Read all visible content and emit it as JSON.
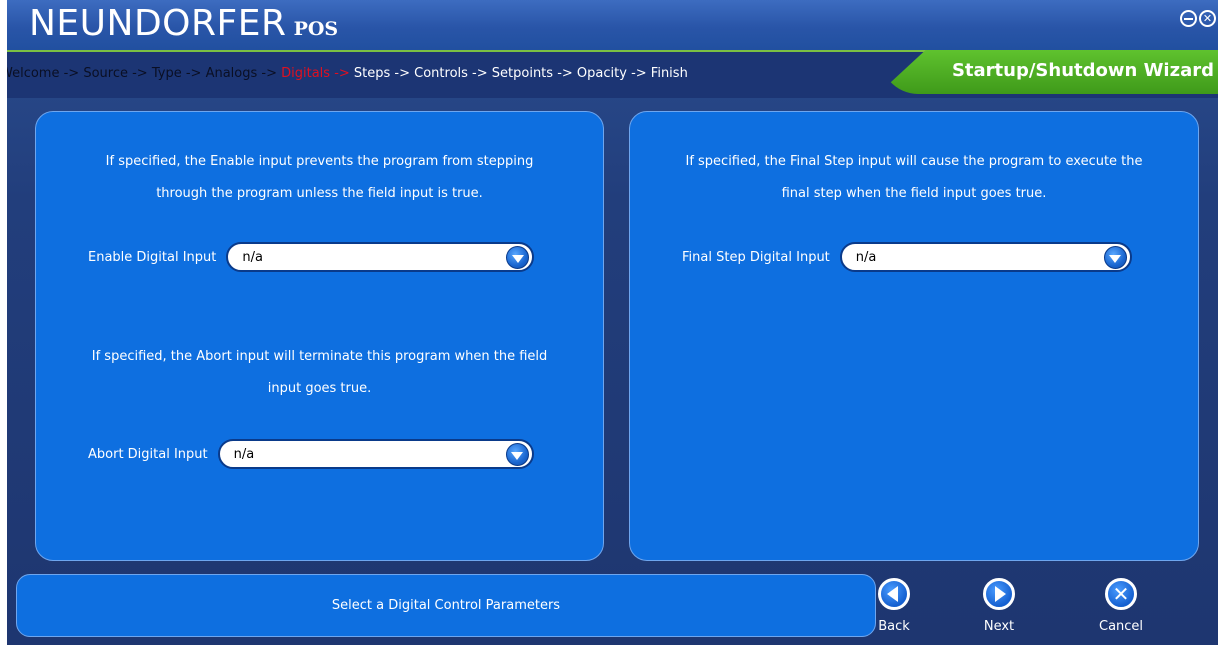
{
  "app": {
    "brand_name": "NEUNDORFER",
    "brand_suffix": "POS",
    "wizard_title": "Startup/Shutdown Wizard"
  },
  "colors": {
    "panel_blue": "#0e6fe0",
    "background_navy": "#1e3670",
    "wizard_tab_green": "#4fae22",
    "current_step_red": "#e01020"
  },
  "window_controls": [
    {
      "name": "minimize",
      "icon": "minimize-circle-icon"
    },
    {
      "name": "close",
      "icon": "close-circle-icon"
    }
  ],
  "breadcrumb": {
    "steps": [
      {
        "label": "Welcome",
        "state": "done"
      },
      {
        "label": "Source",
        "state": "done"
      },
      {
        "label": "Type",
        "state": "done"
      },
      {
        "label": "Analogs",
        "state": "done"
      },
      {
        "label": "Digitals",
        "state": "current"
      },
      {
        "label": "Steps",
        "state": "todo"
      },
      {
        "label": "Controls",
        "state": "todo"
      },
      {
        "label": "Setpoints",
        "state": "todo"
      },
      {
        "label": "Opacity",
        "state": "todo"
      },
      {
        "label": "Finish",
        "state": "todo"
      }
    ],
    "separator": " -> "
  },
  "left_panel": {
    "enable_desc_line1": "If specified, the Enable input prevents the program from stepping",
    "enable_desc_line2": "through the program unless the field input is true.",
    "enable_label": "Enable Digital Input",
    "enable_value": "n/a",
    "abort_desc_line1": "If specified, the Abort input will terminate this program when the field",
    "abort_desc_line2": "input goes true.",
    "abort_label": "Abort Digital Input",
    "abort_value": "n/a"
  },
  "right_panel": {
    "final_desc_line1": "If specified, the Final Step input will cause the program to execute the",
    "final_desc_line2": "final step when the field input goes true.",
    "final_label": "Final Step Digital Input",
    "final_value": "n/a"
  },
  "status": {
    "message": "Select a Digital Control Parameters"
  },
  "nav": {
    "back_label": "Back",
    "next_label": "Next",
    "cancel_label": "Cancel"
  }
}
